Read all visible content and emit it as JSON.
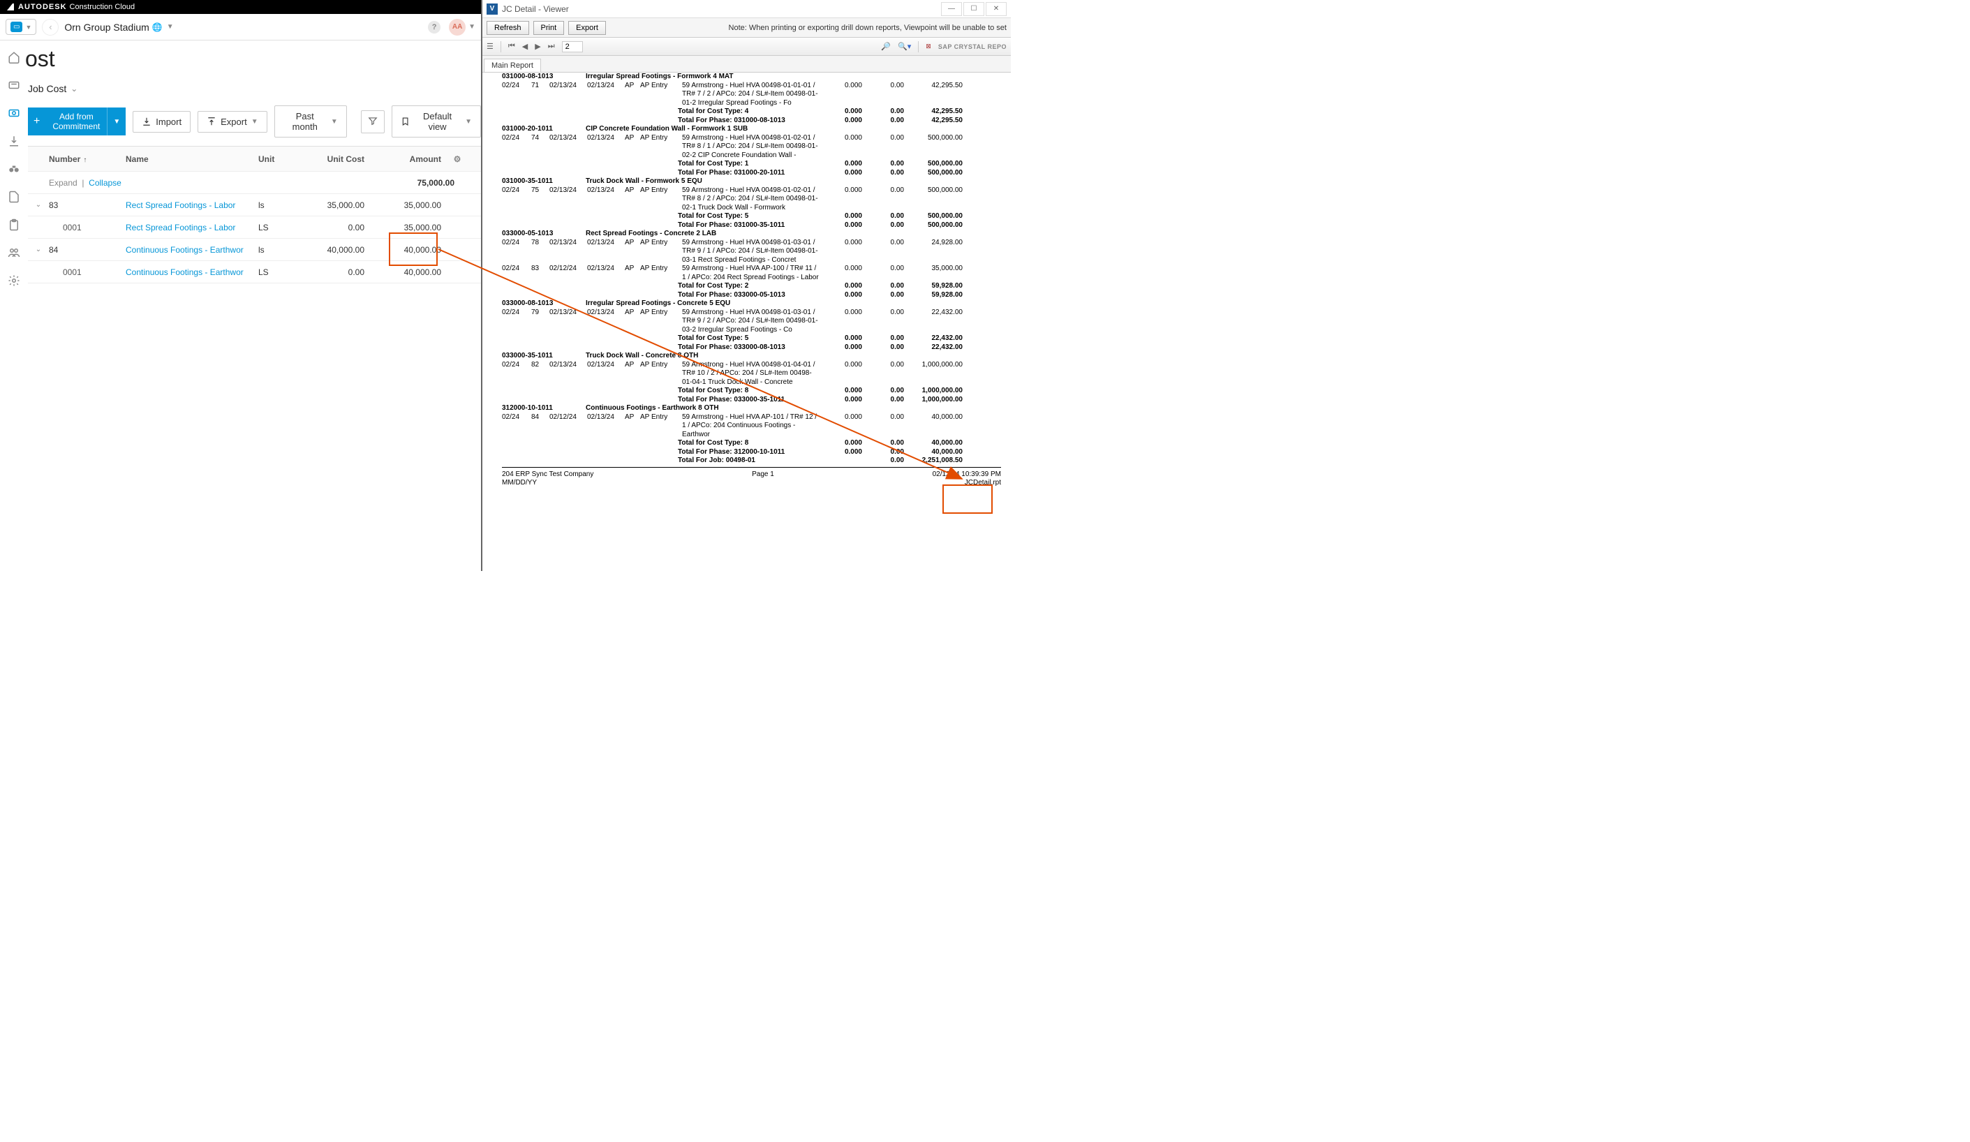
{
  "brand": {
    "name": "AUTODESK",
    "product": "Construction Cloud"
  },
  "project": {
    "name": "Orn Group Stadium",
    "avatar": "AA"
  },
  "page": {
    "title_cut": "ost",
    "breadcrumb": "Job Cost"
  },
  "toolbar": {
    "add_from": "Add from",
    "commitment": "Commitment",
    "import": "Import",
    "export": "Export",
    "past_month": "Past month",
    "default_view": "Default view"
  },
  "grid_header": {
    "number": "Number",
    "name": "Name",
    "unit": "Unit",
    "unit_cost": "Unit Cost",
    "amount": "Amount"
  },
  "expand_collapse": {
    "expand": "Expand",
    "collapse": "Collapse",
    "total": "75,000.00"
  },
  "rows": [
    {
      "chev": "⌄",
      "num": "83",
      "name": "Rect Spread Footings - Labor",
      "unit": "ls",
      "unit_cost": "35,000.00",
      "amount": "35,000.00",
      "link": true
    },
    {
      "chev": "",
      "num": "0001",
      "name": "Rect Spread Footings - Labor",
      "unit": "LS",
      "unit_cost": "0.00",
      "amount": "35,000.00",
      "link": true,
      "indent": true
    },
    {
      "chev": "⌄",
      "num": "84",
      "name": "Continuous Footings - Earthwor",
      "unit": "ls",
      "unit_cost": "40,000.00",
      "amount": "40,000.00",
      "link": true
    },
    {
      "chev": "",
      "num": "0001",
      "name": "Continuous Footings - Earthwor",
      "unit": "LS",
      "unit_cost": "0.00",
      "amount": "40,000.00",
      "link": true,
      "indent": true
    }
  ],
  "viewer": {
    "window_title": "JC Detail - Viewer",
    "buttons": {
      "refresh": "Refresh",
      "print": "Print",
      "export": "Export"
    },
    "note": "Note: When printing or exporting drill down reports, Viewpoint will be unable to set",
    "page_num": "2",
    "crystal": "SAP CRYSTAL REPO",
    "tab": "Main Report",
    "footer": {
      "company": "204 ERP Sync Test Company",
      "datefmt": "MM/DD/YY",
      "page": "Page 1",
      "datetime": "02/12/24 10:39:39 PM",
      "filename": "JCDetail.rpt"
    }
  },
  "report_lines": [
    {
      "t": "phase",
      "code": "031000-08-1013",
      "desc": "Irregular Spread Footings - Formwork  4   MAT"
    },
    {
      "t": "data",
      "c1": "02/24",
      "c2": "71",
      "c3": "02/13/24",
      "c4": "02/13/24",
      "c5": "AP",
      "c6": "AP Entry",
      "desc": "59 Armstrong - Huel HVA 00498-01-01-01 / TR# 7 / 2 / APCo: 204 / SL#-Item 00498-01-01-2  Irregular Spread Footings - Fo",
      "v1": "0.000",
      "v2": "0.00",
      "v3": "42,295.50"
    },
    {
      "t": "total",
      "label": "Total for Cost Type:   4",
      "v1": "0.000",
      "v2": "0.00",
      "v3": "42,295.50"
    },
    {
      "t": "total",
      "label": "Total For Phase: 031000-08-1013",
      "v1": "0.000",
      "v2": "0.00",
      "v3": "42,295.50"
    },
    {
      "t": "phase",
      "code": "031000-20-1011",
      "desc": "CIP Concrete Foundation Wall - Formwork  1   SUB"
    },
    {
      "t": "data",
      "c1": "02/24",
      "c2": "74",
      "c3": "02/13/24",
      "c4": "02/13/24",
      "c5": "AP",
      "c6": "AP Entry",
      "desc": "59 Armstrong - Huel HVA 00498-01-02-01 / TR# 8 / 1 / APCo: 204 / SL#-Item 00498-01-02-2  CIP Concrete Foundation Wall -",
      "v1": "0.000",
      "v2": "0.00",
      "v3": "500,000.00"
    },
    {
      "t": "total",
      "label": "Total for Cost Type:   1",
      "v1": "0.000",
      "v2": "0.00",
      "v3": "500,000.00"
    },
    {
      "t": "total",
      "label": "Total For Phase: 031000-20-1011",
      "v1": "0.000",
      "v2": "0.00",
      "v3": "500,000.00"
    },
    {
      "t": "phase",
      "code": "031000-35-1011",
      "desc": "Truck Dock Wall - Formwork  5   EQU"
    },
    {
      "t": "data",
      "c1": "02/24",
      "c2": "75",
      "c3": "02/13/24",
      "c4": "02/13/24",
      "c5": "AP",
      "c6": "AP Entry",
      "desc": "59 Armstrong - Huel HVA 00498-01-02-01 / TR# 8 / 2 / APCo: 204 / SL#-Item 00498-01-02-1  Truck Dock Wall - Formwork",
      "v1": "0.000",
      "v2": "0.00",
      "v3": "500,000.00"
    },
    {
      "t": "total",
      "label": "Total for Cost Type:   5",
      "v1": "0.000",
      "v2": "0.00",
      "v3": "500,000.00"
    },
    {
      "t": "total",
      "label": "Total For Phase: 031000-35-1011",
      "v1": "0.000",
      "v2": "0.00",
      "v3": "500,000.00"
    },
    {
      "t": "phase",
      "code": "033000-05-1013",
      "desc": "Rect Spread Footings - Concrete  2   LAB"
    },
    {
      "t": "data",
      "c1": "02/24",
      "c2": "78",
      "c3": "02/13/24",
      "c4": "02/13/24",
      "c5": "AP",
      "c6": "AP Entry",
      "desc": "59 Armstrong - Huel HVA 00498-01-03-01 / TR# 9 / 1 / APCo: 204 / SL#-Item 00498-01-03-1  Rect Spread Footings - Concret",
      "v1": "0.000",
      "v2": "0.00",
      "v3": "24,928.00"
    },
    {
      "t": "data",
      "c1": "02/24",
      "c2": "83",
      "c3": "02/12/24",
      "c4": "02/13/24",
      "c5": "AP",
      "c6": "AP Entry",
      "desc": "59 Armstrong - Huel HVA AP-100 / TR# 11 / 1 / APCo: 204  Rect Spread Footings - Labor",
      "v1": "0.000",
      "v2": "0.00",
      "v3": "35,000.00"
    },
    {
      "t": "total",
      "label": "Total for Cost Type:   2",
      "v1": "0.000",
      "v2": "0.00",
      "v3": "59,928.00"
    },
    {
      "t": "total",
      "label": "Total For Phase: 033000-05-1013",
      "v1": "0.000",
      "v2": "0.00",
      "v3": "59,928.00"
    },
    {
      "t": "phase",
      "code": "033000-08-1013",
      "desc": "Irregular Spread Footings - Concrete  5   EQU"
    },
    {
      "t": "data",
      "c1": "02/24",
      "c2": "79",
      "c3": "02/13/24",
      "c4": "02/13/24",
      "c5": "AP",
      "c6": "AP Entry",
      "desc": "59 Armstrong - Huel HVA 00498-01-03-01 / TR# 9 / 2 / APCo: 204 / SL#-Item 00498-01-03-2  Irregular Spread Footings - Co",
      "v1": "0.000",
      "v2": "0.00",
      "v3": "22,432.00"
    },
    {
      "t": "total",
      "label": "Total for Cost Type:   5",
      "v1": "0.000",
      "v2": "0.00",
      "v3": "22,432.00"
    },
    {
      "t": "total",
      "label": "Total For Phase: 033000-08-1013",
      "v1": "0.000",
      "v2": "0.00",
      "v3": "22,432.00"
    },
    {
      "t": "phase",
      "code": "033000-35-1011",
      "desc": "Truck Dock Wall - Concrete  8   OTH"
    },
    {
      "t": "data",
      "c1": "02/24",
      "c2": "82",
      "c3": "02/13/24",
      "c4": "02/13/24",
      "c5": "AP",
      "c6": "AP Entry",
      "desc": "59 Armstrong - Huel HVA 00498-01-04-01 / TR# 10 / 2 / APCo: 204 / SL#-Item 00498-01-04-1  Truck Dock Wall - Concrete",
      "v1": "0.000",
      "v2": "0.00",
      "v3": "1,000,000.00"
    },
    {
      "t": "total",
      "label": "Total for Cost Type:   8",
      "v1": "0.000",
      "v2": "0.00",
      "v3": "1,000,000.00"
    },
    {
      "t": "total",
      "label": "Total For Phase: 033000-35-1011",
      "v1": "0.000",
      "v2": "0.00",
      "v3": "1,000,000.00"
    },
    {
      "t": "phase",
      "code": "312000-10-1011",
      "desc": "Continuous Footings - Earthwork  8   OTH"
    },
    {
      "t": "data",
      "c1": "02/24",
      "c2": "84",
      "c3": "02/12/24",
      "c4": "02/13/24",
      "c5": "AP",
      "c6": "AP Entry",
      "desc": "59 Armstrong - Huel HVA AP-101 / TR# 12 / 1 / APCo: 204  Continuous Footings - Earthwor",
      "v1": "0.000",
      "v2": "0.00",
      "v3": "40,000.00"
    },
    {
      "t": "total",
      "label": "Total for Cost Type:   8",
      "v1": "0.000",
      "v2": "0.00",
      "v3": "40,000.00"
    },
    {
      "t": "total",
      "label": "Total For Phase: 312000-10-1011",
      "v1": "0.000",
      "v2": "0.00",
      "v3": "40,000.00"
    },
    {
      "t": "total",
      "label": "Total For Job: 00498-01",
      "v1": "",
      "v2": "0.00",
      "v3": "2,251,008.50"
    },
    {
      "t": "hr"
    }
  ]
}
